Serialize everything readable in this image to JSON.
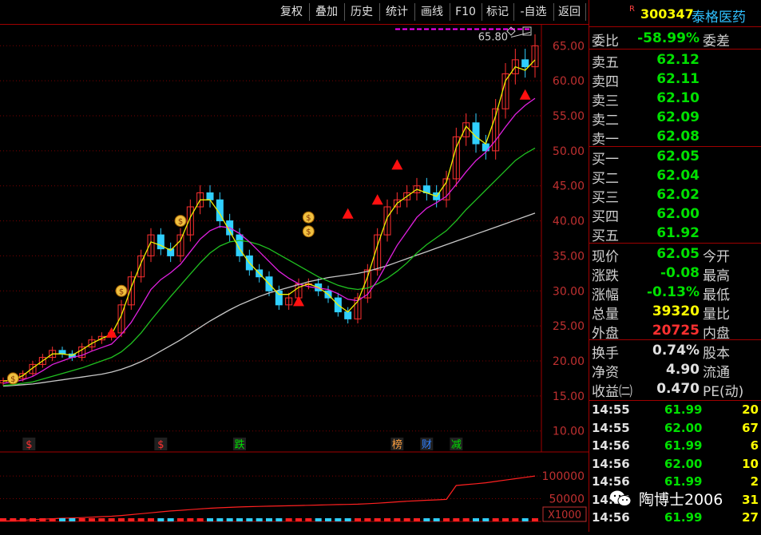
{
  "toolbar": {
    "buttons": [
      "复权",
      "叠加",
      "历史",
      "统计",
      "画线",
      "F10",
      "标记",
      "-自选",
      "返回"
    ]
  },
  "stock": {
    "flag": "R",
    "code": "300347",
    "name": "泰格医药"
  },
  "weibi": {
    "label": "委比",
    "value": "-58.99%",
    "label2": "委差"
  },
  "sell": [
    {
      "label": "卖五",
      "price": "62.12"
    },
    {
      "label": "卖四",
      "price": "62.11"
    },
    {
      "label": "卖三",
      "price": "62.10"
    },
    {
      "label": "卖二",
      "price": "62.09"
    },
    {
      "label": "卖一",
      "price": "62.08"
    }
  ],
  "buy": [
    {
      "label": "买一",
      "price": "62.05"
    },
    {
      "label": "买二",
      "price": "62.04"
    },
    {
      "label": "买三",
      "price": "62.02"
    },
    {
      "label": "买四",
      "price": "62.00"
    },
    {
      "label": "买五",
      "price": "61.92"
    }
  ],
  "quote": [
    {
      "label": "现价",
      "value": "62.05",
      "label2": "今开",
      "color": "#00e000"
    },
    {
      "label": "涨跌",
      "value": "-0.08",
      "label2": "最高",
      "color": "#00e000"
    },
    {
      "label": "涨幅",
      "value": "-0.13%",
      "label2": "最低",
      "color": "#00e000"
    },
    {
      "label": "总量",
      "value": "39320",
      "label2": "量比",
      "color": "#ffff00"
    },
    {
      "label": "外盘",
      "value": "20725",
      "label2": "内盘",
      "color": "#ff3030"
    }
  ],
  "fund": [
    {
      "label": "换手",
      "value": "0.74%",
      "label2": "股本"
    },
    {
      "label": "净资",
      "value": "4.90",
      "label2": "流通"
    },
    {
      "label": "收益㈡",
      "value": "0.470",
      "label2": "PE(动)"
    }
  ],
  "ticks": [
    {
      "time": "14:55",
      "price": "61.99",
      "vol": "20"
    },
    {
      "time": "14:55",
      "price": "62.00",
      "vol": "67"
    },
    {
      "time": "14:56",
      "price": "61.99",
      "vol": "6"
    },
    {
      "time": "14:56",
      "price": "62.00",
      "vol": "10"
    },
    {
      "time": "14:56",
      "price": "61.99",
      "vol": "2"
    },
    {
      "time": "14:56",
      "price": "",
      "vol": "31"
    },
    {
      "time": "14:56",
      "price": "61.99",
      "vol": "27"
    }
  ],
  "watermark": "陶博士2006",
  "chart_data": {
    "type": "candlestick",
    "ylim": [
      7,
      68
    ],
    "yticks": [
      "65.00",
      "60.00",
      "55.00",
      "50.00",
      "45.00",
      "40.00",
      "35.00",
      "30.00",
      "25.00",
      "20.00",
      "15.00",
      "10.00"
    ],
    "high_label": "65.80",
    "closes": [
      17.2,
      17.5,
      18.2,
      19.5,
      20.5,
      21.5,
      21,
      20.5,
      22,
      23,
      23.5,
      24,
      28,
      32,
      35,
      38,
      36,
      35,
      38,
      42,
      44,
      43,
      40,
      38,
      35,
      33,
      32,
      30,
      28,
      29,
      31,
      31,
      30,
      29,
      27,
      26,
      29,
      33,
      38,
      42,
      43,
      44,
      45,
      44,
      43,
      46,
      52,
      54,
      51,
      50,
      56,
      61,
      63,
      62,
      65
    ],
    "ma_yellow": [
      17.1,
      17.3,
      17.9,
      19,
      20,
      21,
      21,
      20.8,
      21.6,
      22.5,
      23.2,
      23.8,
      26.5,
      30.5,
      34,
      37,
      36.5,
      35.8,
      37.2,
      40.5,
      43,
      43,
      41,
      38.5,
      36,
      34,
      32.5,
      31,
      29.5,
      29.5,
      30.5,
      31,
      30.5,
      29.5,
      28,
      27,
      28.5,
      32,
      36.5,
      40.5,
      42.5,
      43.5,
      44.5,
      44,
      43.5,
      45.5,
      50.5,
      53.5,
      52,
      51,
      55,
      60,
      62,
      61.5,
      63
    ],
    "ma_magenta": [
      16.8,
      17,
      17.3,
      17.8,
      18.6,
      19.5,
      20,
      20.5,
      20.8,
      21.4,
      21.9,
      22.4,
      23.8,
      25.5,
      27.8,
      30.2,
      31.6,
      32.6,
      33.8,
      35.6,
      37.4,
      38.6,
      39.2,
      39,
      38.2,
      37,
      35.6,
      34.2,
      32.8,
      31.8,
      31,
      30.6,
      30.4,
      30.2,
      29.6,
      28.8,
      28.6,
      29.5,
      31.5,
      34,
      36.5,
      38.5,
      40.5,
      41.8,
      42.6,
      43.5,
      45.2,
      47,
      48.6,
      49.8,
      51.5,
      53.4,
      55.2,
      56.5,
      57.5
    ],
    "ma_green": [
      16.5,
      16.6,
      16.8,
      17,
      17.4,
      17.8,
      18.2,
      18.6,
      19,
      19.5,
      20,
      20.5,
      21.3,
      22.5,
      24,
      25.8,
      27.5,
      29.2,
      30.8,
      32.4,
      34,
      35.4,
      36.4,
      37,
      37.2,
      37,
      36.6,
      36,
      35.2,
      34.4,
      33.6,
      32.8,
      32,
      31.4,
      30.8,
      30.4,
      30.2,
      30.4,
      31,
      31.8,
      32.8,
      34,
      35.4,
      36.6,
      37.6,
      38.6,
      40,
      41.6,
      43,
      44.4,
      45.8,
      47.2,
      48.6,
      49.6,
      50.4
    ],
    "ma_white": [
      16.4,
      16.5,
      16.6,
      16.7,
      16.9,
      17.1,
      17.3,
      17.5,
      17.7,
      17.9,
      18.1,
      18.4,
      18.8,
      19.3,
      19.9,
      20.6,
      21.4,
      22.2,
      23,
      23.9,
      24.8,
      25.7,
      26.5,
      27.3,
      28,
      28.6,
      29.2,
      29.7,
      30.1,
      30.5,
      30.9,
      31.3,
      31.6,
      31.9,
      32.1,
      32.3,
      32.5,
      32.8,
      33.2,
      33.6,
      34.1,
      34.6,
      35.1,
      35.6,
      36.1,
      36.6,
      37.1,
      37.6,
      38.1,
      38.6,
      39.1,
      39.6,
      40.1,
      40.6,
      41.1
    ],
    "markers": [
      {
        "text": "$",
        "idx": 1,
        "y": 17.5
      },
      {
        "text": "$",
        "idx": 12,
        "y": 30
      },
      {
        "text": "$",
        "idx": 18,
        "y": 40
      },
      {
        "text": "$",
        "idx": 31,
        "y": 40.5
      },
      {
        "text": "$",
        "idx": 31,
        "y": 38.5
      }
    ],
    "buy_signals": [
      {
        "idx": 11,
        "y": 24
      },
      {
        "idx": 30,
        "y": 28.5
      },
      {
        "idx": 35,
        "y": 41
      },
      {
        "idx": 38,
        "y": 43
      },
      {
        "idx": 40,
        "y": 48
      },
      {
        "idx": 53,
        "y": 58
      }
    ],
    "events": [
      {
        "text": "$",
        "idx": 1,
        "color": "#ff3030"
      },
      {
        "text": "$",
        "idx": 16,
        "color": "#ff3030"
      },
      {
        "text": "跌",
        "idx": 24,
        "color": "#00e000"
      },
      {
        "text": "榜",
        "idx": 40,
        "color": "#ffa040"
      },
      {
        "text": "财",
        "idx": 43,
        "color": "#3080ff"
      },
      {
        "text": "减",
        "idx": 46,
        "color": "#00e000"
      }
    ],
    "volume": {
      "yticks": [
        "100000",
        "50000"
      ],
      "unit": "X1000",
      "ylim": [
        0,
        130000
      ],
      "cum": [
        1000,
        1500,
        2500,
        4000,
        5000,
        6000,
        7000,
        7500,
        8500,
        9500,
        10500,
        11500,
        13000,
        15000,
        17000,
        19000,
        21000,
        23000,
        24500,
        26000,
        27500,
        29000,
        30000,
        31000,
        31800,
        32500,
        33000,
        33500,
        34000,
        34500,
        35000,
        35500,
        36000,
        36500,
        37000,
        37500,
        38000,
        39000,
        40000,
        41500,
        43000,
        44500,
        45500,
        46500,
        47500,
        48500,
        79000,
        81000,
        83000,
        85000,
        88000,
        91000,
        94000,
        97000,
        100000
      ]
    }
  }
}
